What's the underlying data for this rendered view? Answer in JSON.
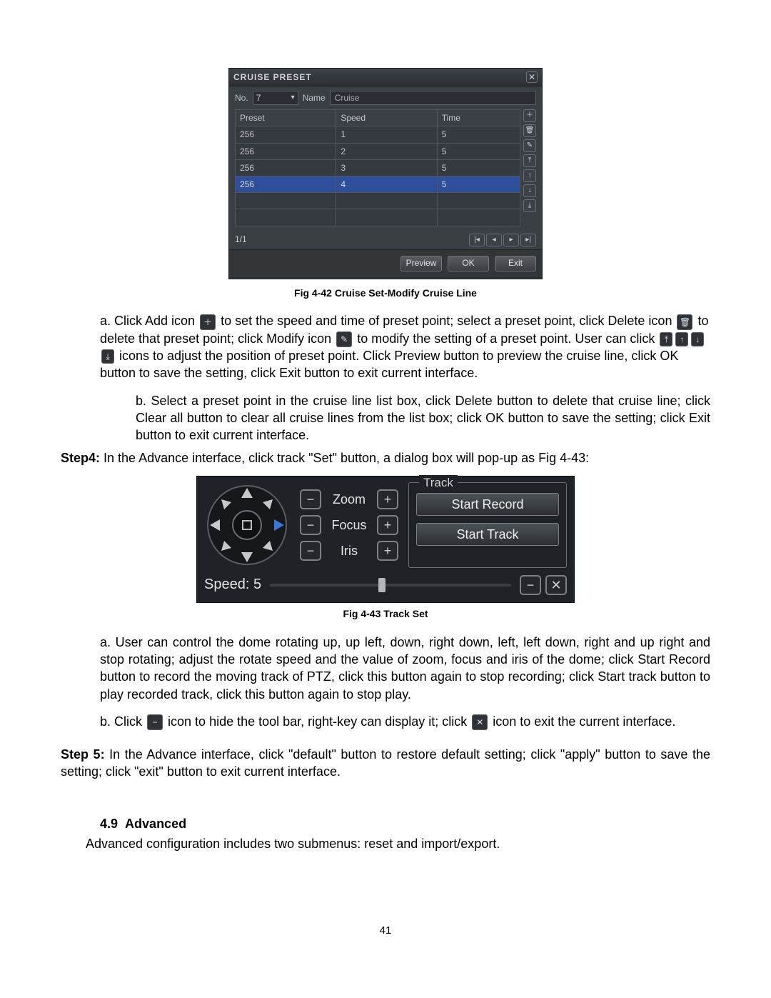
{
  "cruise": {
    "title": "CRUISE PRESET",
    "no_label": "No.",
    "no_value": "7",
    "name_label": "Name",
    "name_value": "Cruise",
    "cols": {
      "preset": "Preset",
      "speed": "Speed",
      "time": "Time"
    },
    "rows": [
      {
        "preset": "256",
        "speed": "1",
        "time": "5",
        "sel": false
      },
      {
        "preset": "256",
        "speed": "2",
        "time": "5",
        "sel": false
      },
      {
        "preset": "256",
        "speed": "3",
        "time": "5",
        "sel": false
      },
      {
        "preset": "256",
        "speed": "4",
        "time": "5",
        "sel": true
      },
      {
        "preset": "",
        "speed": "",
        "time": "",
        "sel": false
      },
      {
        "preset": "",
        "speed": "",
        "time": "",
        "sel": false
      }
    ],
    "pager": "1/1",
    "buttons": {
      "preview": "Preview",
      "ok": "OK",
      "exit": "Exit"
    }
  },
  "caption1": "Fig 4-42 Cruise Set-Modify Cruise Line",
  "text": {
    "a_prefix": "a.   Click Add icon ",
    "a_mid1": " to set the speed and time of preset point; select a preset point, click Delete icon ",
    "a_mid2": "to delete that preset point; click Modify icon ",
    "a_mid3": " to modify the setting of a preset point. User can click",
    "a_tail": " icons to adjust the position of preset point. Click Preview button to preview the cruise line, click OK button to save the setting, click Exit button to exit current interface.",
    "b_text": "b.   Select a preset point in the cruise line list box, click Delete button to delete that cruise line; click Clear all button to clear all cruise lines from the list box; click OK button to save the setting; click Exit button to exit current interface.",
    "step4": "Step4: In the Advance interface, click track \"Set\" button, a dialog box will pop-up as Fig 4-43:"
  },
  "track": {
    "zoom": "Zoom",
    "focus": "Focus",
    "iris": "Iris",
    "legend": "Track",
    "start_record": "Start Record",
    "start_track": "Start Track",
    "speed_label": "Speed:",
    "speed_value": "5"
  },
  "caption2": "Fig 4-43 Track Set",
  "text2": {
    "a": "a.   User can control the dome rotating up, up left, down, right down, left, left down, right and up right and stop rotating; adjust the rotate speed and the value of zoom, focus and iris of the dome; click Start Record button to record the moving track of PTZ, click this button again to stop recording; click Start track button to play recorded track, click this button again to stop play.",
    "b_pre": "b.   Click ",
    "b_mid": " icon to hide the tool bar, right-key can display it; click ",
    "b_post": " icon to exit the current interface.",
    "step5_pre": "Step 5:",
    "step5_body": " In the Advance interface, click \"default\" button to restore default setting; click \"apply\" button to save the setting; click \"exit\" button to exit current interface.",
    "sec_num": "4.9",
    "sec_title": "Advanced",
    "sec_body": "Advanced configuration includes two submenus: reset and import/export."
  },
  "pagenum": "41",
  "chart_data": {
    "type": "table",
    "title": "Cruise Preset rows",
    "columns": [
      "Preset",
      "Speed",
      "Time"
    ],
    "rows": [
      [
        "256",
        "1",
        "5"
      ],
      [
        "256",
        "2",
        "5"
      ],
      [
        "256",
        "3",
        "5"
      ],
      [
        "256",
        "4",
        "5"
      ]
    ]
  }
}
